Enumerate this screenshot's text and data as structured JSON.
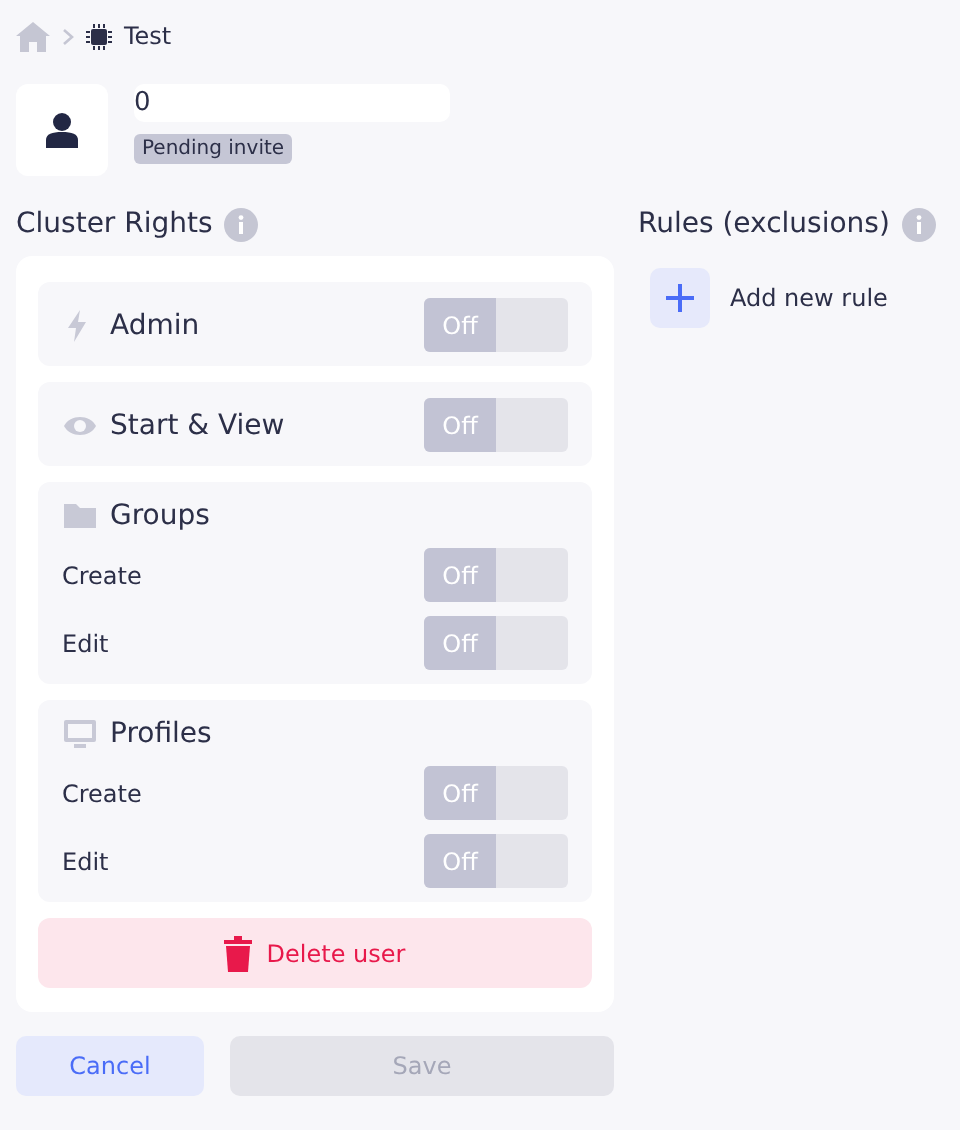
{
  "breadcrumb": {
    "current": "Test"
  },
  "user": {
    "name": "0",
    "status": "Pending invite"
  },
  "cluster_rights": {
    "title": "Cluster Rights",
    "sections": [
      {
        "kind": "single",
        "label": "Admin",
        "toggle": {
          "on": false,
          "label": "Off"
        }
      },
      {
        "kind": "single",
        "label": "Start & View",
        "toggle": {
          "on": false,
          "label": "Off"
        }
      },
      {
        "kind": "group",
        "label": "Groups",
        "rows": [
          {
            "label": "Create",
            "toggle": {
              "on": false,
              "label": "Off"
            }
          },
          {
            "label": "Edit",
            "toggle": {
              "on": false,
              "label": "Off"
            }
          }
        ]
      },
      {
        "kind": "group",
        "label": "Profiles",
        "rows": [
          {
            "label": "Create",
            "toggle": {
              "on": false,
              "label": "Off"
            }
          },
          {
            "label": "Edit",
            "toggle": {
              "on": false,
              "label": "Off"
            }
          }
        ]
      }
    ],
    "delete_button": "Delete user"
  },
  "rules": {
    "title": "Rules (exclusions)",
    "add_button": "Add new rule"
  },
  "buttons": [
    {
      "label": "Cancel",
      "disabled": false
    },
    {
      "label": "Save",
      "disabled": true
    }
  ]
}
